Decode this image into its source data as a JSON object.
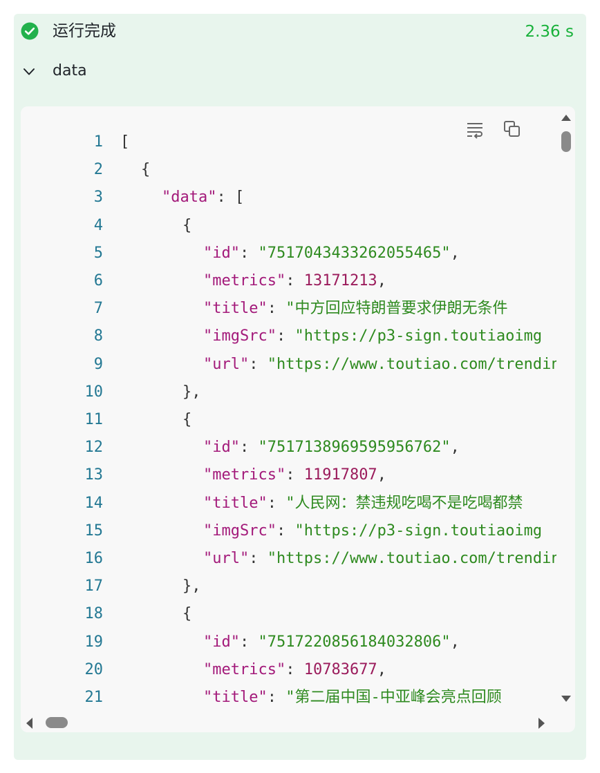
{
  "header": {
    "status_text": "运行完成",
    "elapsed": "2.36 s",
    "status_color": "#22b14c",
    "status_icon": "check-circle-icon"
  },
  "section": {
    "label": "data",
    "expanded": true,
    "toggle_icon": "chevron-down-icon"
  },
  "toolbar": {
    "wrap_icon": "wrap-lines-icon",
    "copy_icon": "copy-icon"
  },
  "code_lines": [
    {
      "n": "1",
      "indent": 0,
      "parts": [
        {
          "t": "[",
          "c": "punc"
        }
      ]
    },
    {
      "n": "2",
      "indent": 1,
      "parts": [
        {
          "t": "{",
          "c": "punc"
        }
      ]
    },
    {
      "n": "3",
      "indent": 2,
      "parts": [
        {
          "t": "\"data\"",
          "c": "key"
        },
        {
          "t": ": [",
          "c": "punc"
        }
      ]
    },
    {
      "n": "4",
      "indent": 3,
      "parts": [
        {
          "t": "{",
          "c": "punc"
        }
      ]
    },
    {
      "n": "5",
      "indent": 4,
      "parts": [
        {
          "t": "\"id\"",
          "c": "key"
        },
        {
          "t": ": ",
          "c": "punc"
        },
        {
          "t": "\"7517043433262055465\"",
          "c": "str"
        },
        {
          "t": ",",
          "c": "punc"
        }
      ]
    },
    {
      "n": "6",
      "indent": 4,
      "parts": [
        {
          "t": "\"metrics\"",
          "c": "key"
        },
        {
          "t": ": ",
          "c": "punc"
        },
        {
          "t": "13171213",
          "c": "num"
        },
        {
          "t": ",",
          "c": "punc"
        }
      ]
    },
    {
      "n": "7",
      "indent": 4,
      "parts": [
        {
          "t": "\"title\"",
          "c": "key"
        },
        {
          "t": ": ",
          "c": "punc"
        },
        {
          "t": "\"中方回应特朗普要求伊朗无条件",
          "c": "str"
        }
      ]
    },
    {
      "n": "8",
      "indent": 4,
      "parts": [
        {
          "t": "\"imgSrc\"",
          "c": "key"
        },
        {
          "t": ": ",
          "c": "punc"
        },
        {
          "t": "\"https://p3-sign.toutiaoimg",
          "c": "str"
        }
      ]
    },
    {
      "n": "9",
      "indent": 4,
      "parts": [
        {
          "t": "\"url\"",
          "c": "key"
        },
        {
          "t": ": ",
          "c": "punc"
        },
        {
          "t": "\"https://www.toutiao.com/trending",
          "c": "str"
        }
      ]
    },
    {
      "n": "10",
      "indent": 3,
      "parts": [
        {
          "t": "},",
          "c": "punc"
        }
      ]
    },
    {
      "n": "11",
      "indent": 3,
      "parts": [
        {
          "t": "{",
          "c": "punc"
        }
      ]
    },
    {
      "n": "12",
      "indent": 4,
      "parts": [
        {
          "t": "\"id\"",
          "c": "key"
        },
        {
          "t": ": ",
          "c": "punc"
        },
        {
          "t": "\"7517138969595956762\"",
          "c": "str"
        },
        {
          "t": ",",
          "c": "punc"
        }
      ]
    },
    {
      "n": "13",
      "indent": 4,
      "parts": [
        {
          "t": "\"metrics\"",
          "c": "key"
        },
        {
          "t": ": ",
          "c": "punc"
        },
        {
          "t": "11917807",
          "c": "num"
        },
        {
          "t": ",",
          "c": "punc"
        }
      ]
    },
    {
      "n": "14",
      "indent": 4,
      "parts": [
        {
          "t": "\"title\"",
          "c": "key"
        },
        {
          "t": ": ",
          "c": "punc"
        },
        {
          "t": "\"人民网：禁违规吃喝不是吃喝都禁",
          "c": "str"
        }
      ]
    },
    {
      "n": "15",
      "indent": 4,
      "parts": [
        {
          "t": "\"imgSrc\"",
          "c": "key"
        },
        {
          "t": ": ",
          "c": "punc"
        },
        {
          "t": "\"https://p3-sign.toutiaoimg",
          "c": "str"
        }
      ]
    },
    {
      "n": "16",
      "indent": 4,
      "parts": [
        {
          "t": "\"url\"",
          "c": "key"
        },
        {
          "t": ": ",
          "c": "punc"
        },
        {
          "t": "\"https://www.toutiao.com/trending",
          "c": "str"
        }
      ]
    },
    {
      "n": "17",
      "indent": 3,
      "parts": [
        {
          "t": "},",
          "c": "punc"
        }
      ]
    },
    {
      "n": "18",
      "indent": 3,
      "parts": [
        {
          "t": "{",
          "c": "punc"
        }
      ]
    },
    {
      "n": "19",
      "indent": 4,
      "parts": [
        {
          "t": "\"id\"",
          "c": "key"
        },
        {
          "t": ": ",
          "c": "punc"
        },
        {
          "t": "\"7517220856184032806\"",
          "c": "str"
        },
        {
          "t": ",",
          "c": "punc"
        }
      ]
    },
    {
      "n": "20",
      "indent": 4,
      "parts": [
        {
          "t": "\"metrics\"",
          "c": "key"
        },
        {
          "t": ": ",
          "c": "punc"
        },
        {
          "t": "10783677",
          "c": "num"
        },
        {
          "t": ",",
          "c": "punc"
        }
      ]
    },
    {
      "n": "21",
      "indent": 4,
      "parts": [
        {
          "t": "\"title\"",
          "c": "key"
        },
        {
          "t": ": ",
          "c": "punc"
        },
        {
          "t": "\"第二届中国-中亚峰会亮点回顾",
          "c": "str"
        }
      ]
    }
  ]
}
